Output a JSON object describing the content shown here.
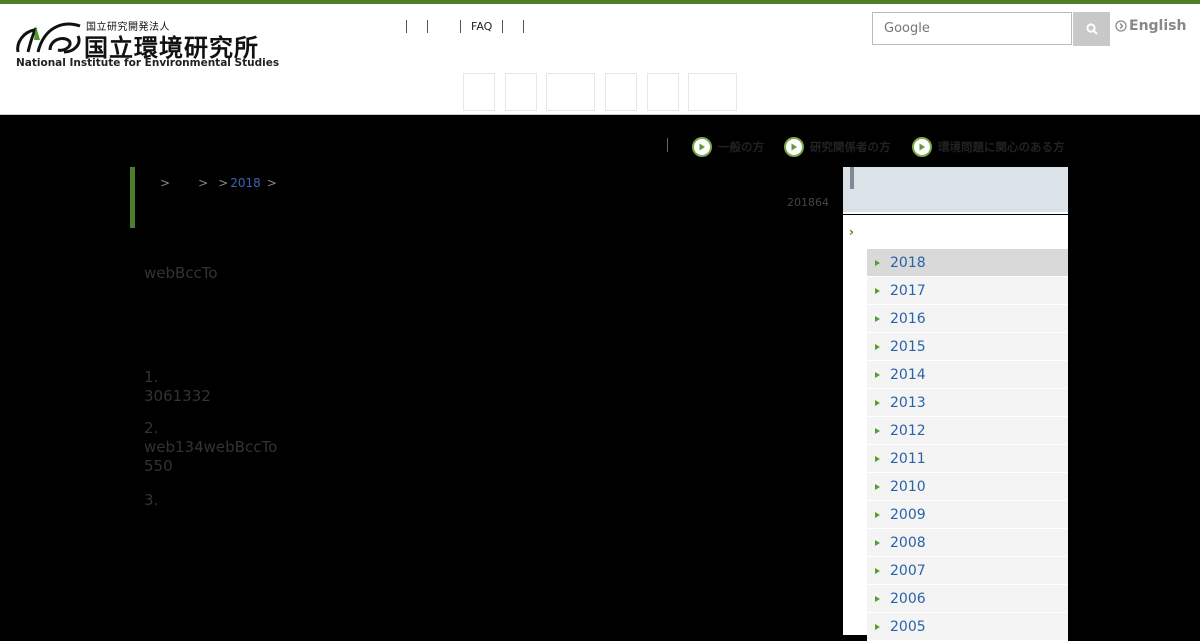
{
  "header": {
    "logo": {
      "small_text": "国立研究開発法人",
      "big_text": "国立環境研究所",
      "english_text": "National Institute for Environmental Studies"
    },
    "util_nav": [
      "",
      "",
      "FAQ",
      ""
    ],
    "search": {
      "placeholder": "Google"
    },
    "language_link": "English"
  },
  "audience_links": [
    "一般の方",
    "研究関係者の方",
    "環境問題に関心のある方"
  ],
  "breadcrumb": [
    ">",
    ">",
    ">",
    "2018",
    ">"
  ],
  "date": "201864",
  "body": {
    "intro": "webBccTo",
    "list": [
      {
        "num": "1.",
        "text": "3061332"
      },
      {
        "num": "2.",
        "text": "web134webBccTo",
        "text2": "550"
      },
      {
        "num": "3.",
        "text": ""
      }
    ]
  },
  "sidebar": {
    "years": [
      "2018",
      "2017",
      "2016",
      "2015",
      "2014",
      "2013",
      "2012",
      "2011",
      "2010",
      "2009",
      "2008",
      "2007",
      "2006",
      "2005"
    ],
    "active_year": "2018"
  },
  "colors": {
    "accent_green": "#4e7d2c",
    "link_blue": "#2a62a8"
  }
}
